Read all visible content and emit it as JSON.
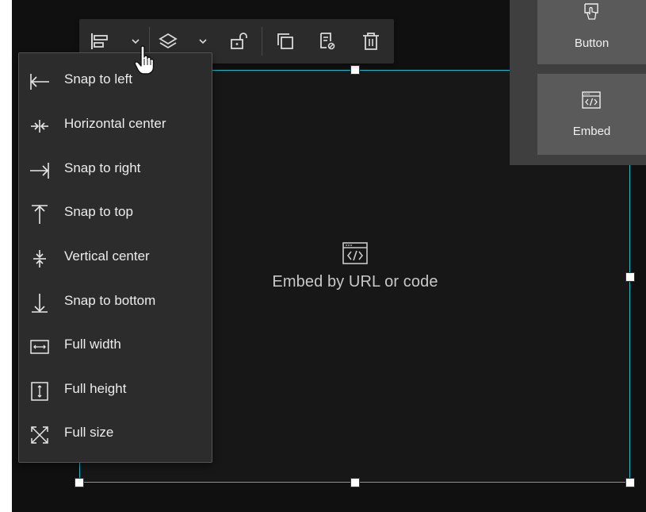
{
  "toolbar": {
    "align_icon": "align-left-icon",
    "align_chevron": "chevron-down-icon",
    "layer_icon": "layers-icon",
    "layer_chevron": "chevron-down-icon",
    "lock_icon": "unlock-icon",
    "duplicate_icon": "duplicate-icon",
    "edit_icon": "edit-settings-icon",
    "delete_icon": "trash-icon"
  },
  "menu": {
    "items": [
      {
        "label": "Snap to left",
        "icon": "snap-left-icon"
      },
      {
        "label": "Horizontal center",
        "icon": "horizontal-center-icon"
      },
      {
        "label": "Snap to right",
        "icon": "snap-right-icon"
      },
      {
        "label": "Snap to top",
        "icon": "snap-top-icon"
      },
      {
        "label": "Vertical center",
        "icon": "vertical-center-icon"
      },
      {
        "label": "Snap to bottom",
        "icon": "snap-bottom-icon"
      },
      {
        "label": "Full width",
        "icon": "full-width-icon"
      },
      {
        "label": "Full height",
        "icon": "full-height-icon"
      },
      {
        "label": "Full size",
        "icon": "full-size-icon"
      }
    ]
  },
  "placeholder": {
    "text": "Embed by URL or code",
    "icon": "embed-icon"
  },
  "panel": {
    "widgets": [
      {
        "label": "Button",
        "icon": "button-pointer-icon"
      },
      {
        "label": "Embed",
        "icon": "embed-icon"
      }
    ]
  },
  "colors": {
    "accent": "#26b7c7",
    "canvas_bg": "#101010",
    "menu_bg": "#2c2c2c",
    "toolbar_bg": "#2b2b2b"
  }
}
